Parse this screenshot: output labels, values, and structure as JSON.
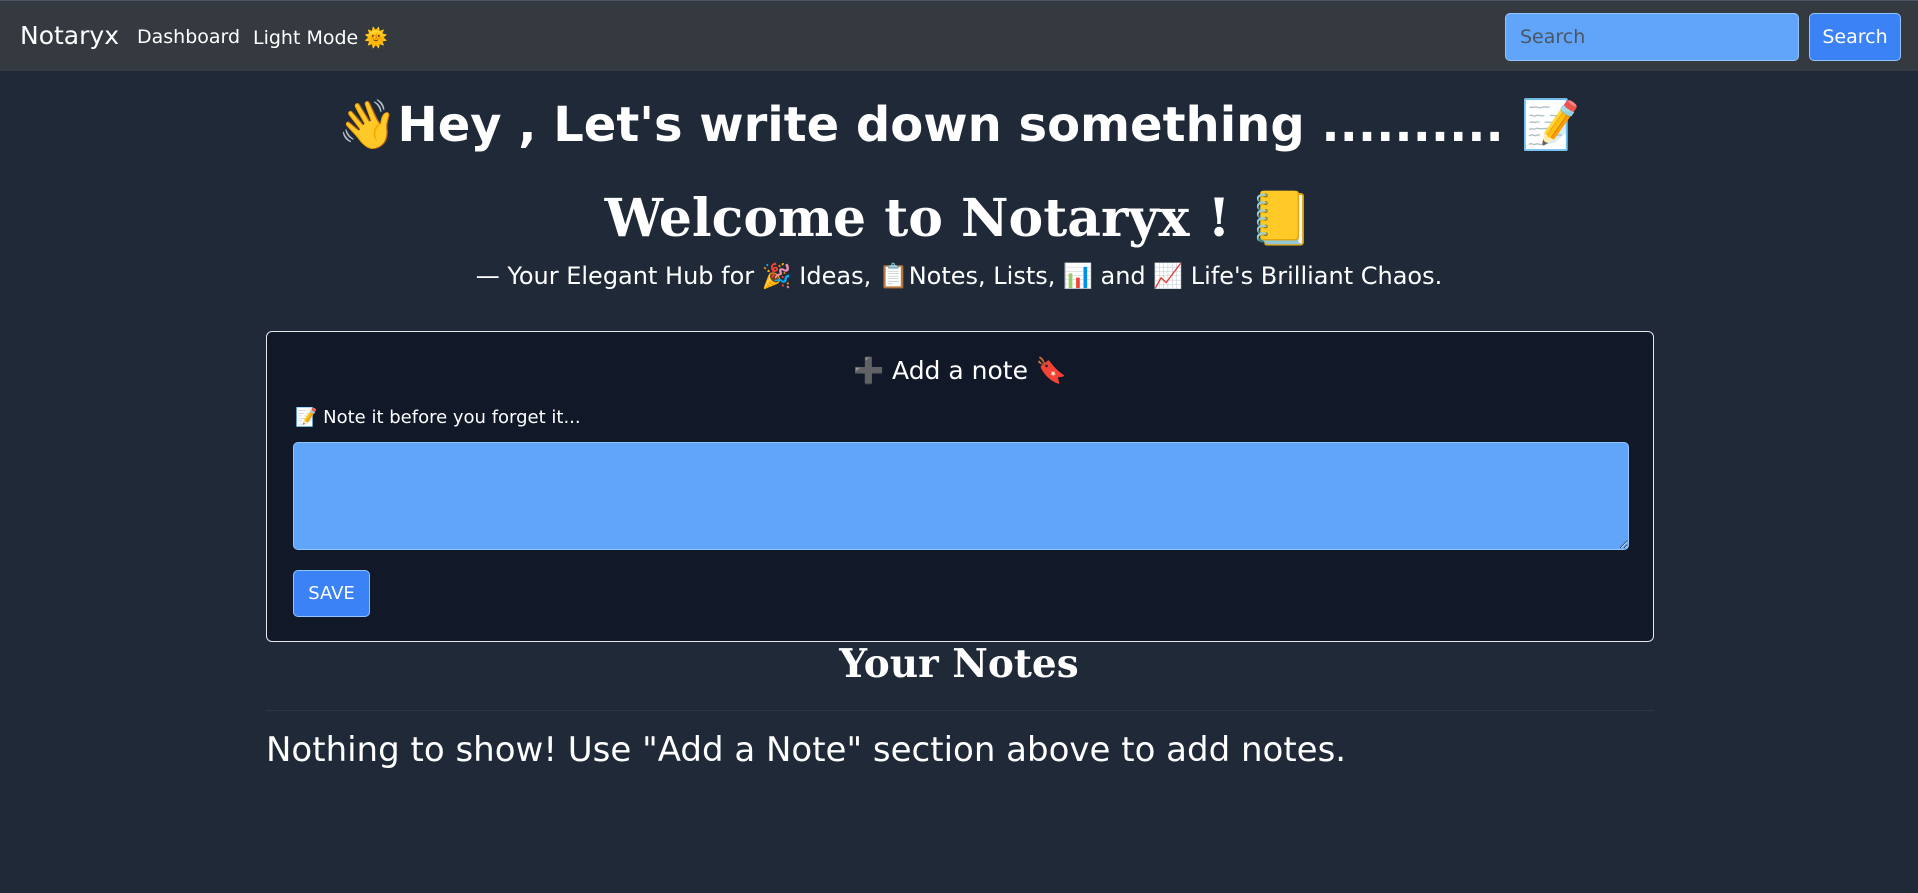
{
  "navbar": {
    "brand": "Notaryx",
    "links": [
      "Dashboard",
      "Light Mode 🌞"
    ],
    "search": {
      "placeholder": "Search",
      "button_label": "Search"
    }
  },
  "hero": {
    "heading": "👋Hey , Let's write down something .......... 📝",
    "welcome": "Welcome to Notaryx ! 📒",
    "tagline": "— Your Elegant Hub for 🎉 Ideas, 📋Notes, Lists, 📊 and 📈 Life's Brilliant Chaos."
  },
  "add_note": {
    "title": "➕ Add a note 🔖",
    "label": "📝 Note it before you forget it...",
    "textarea_value": "",
    "save_label": "SAVE"
  },
  "notes": {
    "heading": "Your Notes",
    "empty_message": "Nothing to show! Use \"Add a Note\" section above to add notes."
  },
  "colors": {
    "background": "#1f2937",
    "navbar": "#343a40",
    "card": "#111827",
    "input": "#60a5fa",
    "button": "#3b82f6"
  }
}
